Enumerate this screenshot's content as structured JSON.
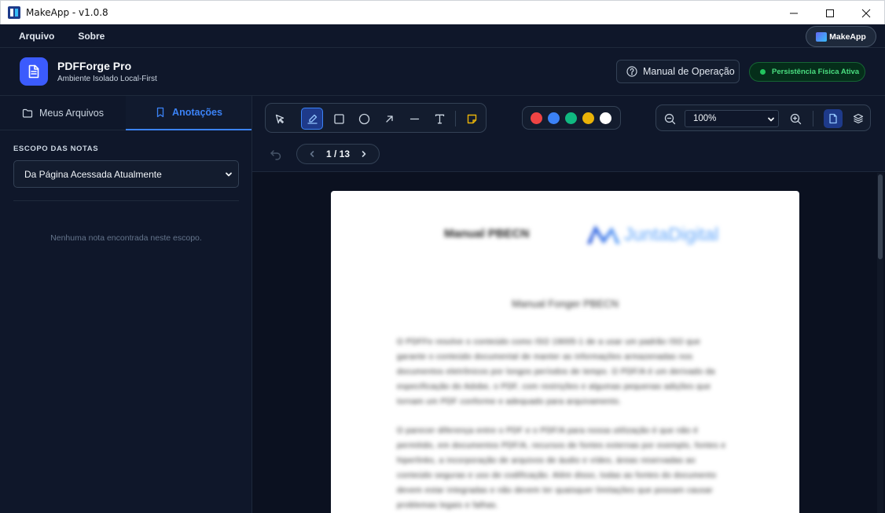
{
  "window": {
    "title": "MakeApp - v1.0.8"
  },
  "menu": {
    "items": [
      "Arquivo",
      "Sobre"
    ],
    "badge": "MakeApp"
  },
  "header": {
    "app_name": "PDFForge Pro",
    "subtitle": "Ambiente Isolado Local-First",
    "manual_label": "Manual de Operação",
    "status_label": "Persistência Física Ativa"
  },
  "sidebar": {
    "tabs": [
      {
        "label": "Meus Arquivos",
        "icon": "folder-icon"
      },
      {
        "label": "Anotações",
        "icon": "bookmark-icon",
        "active": true
      }
    ],
    "scope_label": "ESCOPO DAS NOTAS",
    "scope_value": "Da Página Acessada Atualmente",
    "empty_message": "Nenhuma nota encontrada neste escopo."
  },
  "toolbar": {
    "tools": [
      "select",
      "highlight",
      "rectangle",
      "ellipse",
      "arrow",
      "line",
      "text",
      "note"
    ],
    "active_tool": "highlight",
    "colors": [
      "#ef4444",
      "#3b82f6",
      "#10b981",
      "#eab308",
      "#ffffff"
    ],
    "zoom_value": "100%",
    "pager": "1 / 13"
  },
  "document": {
    "header_left": "Manual PBECN",
    "logo_text": "JuntaDigital",
    "title": "Manual Fonger PBECN",
    "lines": [
      "O PDFFe resolve o conteúdo como ISO 19005-1 de a usar um padrão ISO que",
      "garante o conteúdo documental de manter as informações armazenadas nos",
      "documentos eletrônicos por longos períodos de tempo. O PDF/A é um derivado da",
      "especificação do Adobe, o PDF, com restrições e algumas pequenas adições que",
      "tornam um PDF conforme e adequado para arquivamento.",
      "O parecer diferença entre o PDF e o PDF/A para nossa utilização é que não é",
      "permitido, em documentos PDF/A, recursos de fontes externas por exemplo, fontes e",
      "hiperlinks, a incorporação de arquivos de áudio e vídeo, áreas reservadas ao",
      "conteúdo seguras e uso de codificação. Além disso, todas as fontes do documento",
      "devem estar integradas e não devem ter quaisquer limitações que possam causar",
      "problemas legais e falhas."
    ]
  }
}
